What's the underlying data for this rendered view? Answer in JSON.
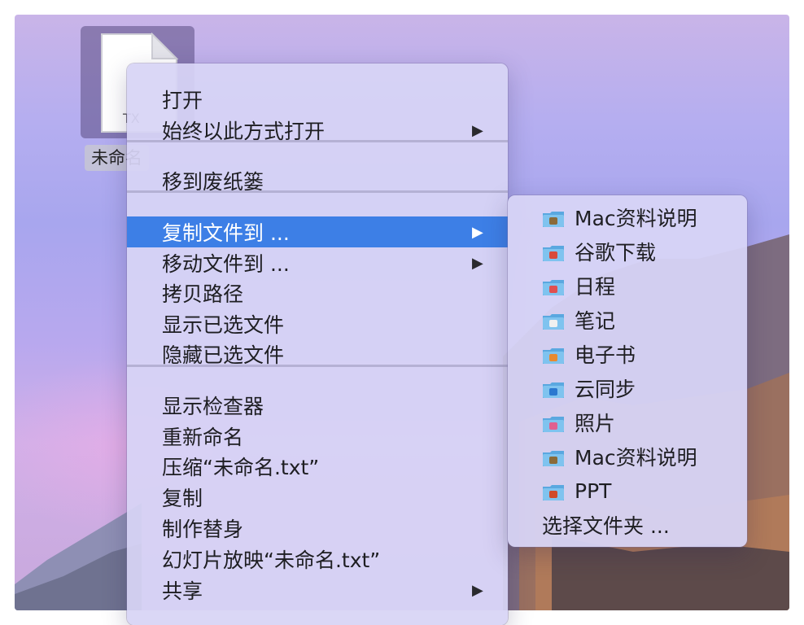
{
  "desktop": {
    "file": {
      "name": "未命名",
      "badge": "TX"
    }
  },
  "context_menu": {
    "items": [
      {
        "label": "打开",
        "submenu": false,
        "highlighted": false
      },
      {
        "label": "始终以此方式打开",
        "submenu": true,
        "highlighted": false
      },
      {
        "label": "移到废纸篓",
        "submenu": false,
        "highlighted": false
      },
      {
        "label": "复制文件到 ...",
        "submenu": true,
        "highlighted": true
      },
      {
        "label": "移动文件到 ...",
        "submenu": true,
        "highlighted": false
      },
      {
        "label": "拷贝路径",
        "submenu": false,
        "highlighted": false
      },
      {
        "label": "显示已选文件",
        "submenu": false,
        "highlighted": false
      },
      {
        "label": "隐藏已选文件",
        "submenu": false,
        "highlighted": false
      },
      {
        "label": "显示检查器",
        "submenu": false,
        "highlighted": false
      },
      {
        "label": "重新命名",
        "submenu": false,
        "highlighted": false
      },
      {
        "label": "压缩“未命名.txt”",
        "submenu": false,
        "highlighted": false
      },
      {
        "label": "复制",
        "submenu": false,
        "highlighted": false
      },
      {
        "label": "制作替身",
        "submenu": false,
        "highlighted": false
      },
      {
        "label": "幻灯片放映“未命名.txt”",
        "submenu": false,
        "highlighted": false
      },
      {
        "label": "共享",
        "submenu": true,
        "highlighted": false
      }
    ],
    "submenu_arrow": "▶"
  },
  "copy_to_submenu": {
    "items": [
      {
        "label": "Mac资料说明",
        "icon": "folder-image-icon"
      },
      {
        "label": "谷歌下载",
        "icon": "folder-chrome-icon"
      },
      {
        "label": "日程",
        "icon": "folder-calendar-icon"
      },
      {
        "label": "笔记",
        "icon": "folder-notes-icon"
      },
      {
        "label": "电子书",
        "icon": "folder-books-icon"
      },
      {
        "label": "云同步",
        "icon": "folder-cloud-icon"
      },
      {
        "label": "照片",
        "icon": "folder-photos-icon"
      },
      {
        "label": "Mac资料说明",
        "icon": "folder-image-icon"
      },
      {
        "label": "PPT",
        "icon": "folder-powerpoint-icon"
      }
    ],
    "choose_folder": "选择文件夹 ..."
  },
  "colors": {
    "highlight": "#3d7fe6",
    "menu_bg": "#d7d4f5",
    "folder": "#6cb6e8"
  }
}
